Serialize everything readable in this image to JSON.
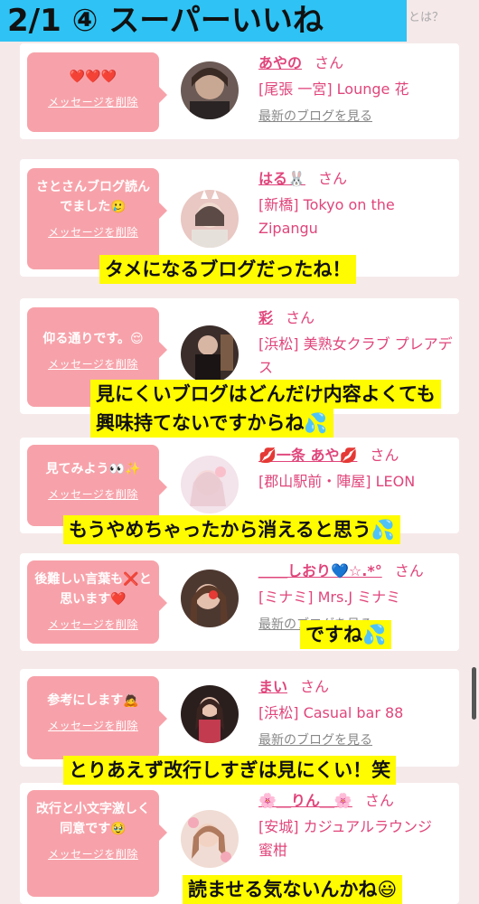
{
  "header": {
    "title": "2/1 ④ スーパーいいね",
    "help_link": "とは？"
  },
  "delete_label": "メッセージを削除",
  "blog_link_label": "最新のブログを見る",
  "san_label": "さん",
  "entries": [
    {
      "message": "❤️❤️❤️",
      "name": "あやの",
      "location": "[尾張 一宮] Lounge 花"
    },
    {
      "message": "さとさんブログ読んでました🥲",
      "name": "はる🐰",
      "location": "[新橋] Tokyo on the Zipangu"
    },
    {
      "message": "仰る通りです。😌",
      "name": "彩",
      "location": "[浜松] 美熟女クラブ プレアデス"
    },
    {
      "message": "見てみよう👀✨",
      "name": "💋一条 あや💋",
      "location": "[郡山駅前・陣屋] LEON"
    },
    {
      "message": "後難しい言葉も❌と思います❤️",
      "name": "＿＿しおり💙☆.*°",
      "location": "[ミナミ] Mrs.J ミナミ"
    },
    {
      "message": "参考にします🙇",
      "name": "まい",
      "location": "[浜松] Casual bar 88"
    },
    {
      "message": "改行と小文字激しく同意です🥹",
      "name": "🌸＿りん＿🌸",
      "location": "[安城] カジュアルラウンジ　蜜柑"
    }
  ],
  "overlays": {
    "o1": "タメになるブログだったね！",
    "o2a": "見にくいブログはどんだけ内容よくても",
    "o2b": "興味持てないですからね💦",
    "o3": "もうやめちゃったから消えると思う💦",
    "o4": "ですね💦",
    "o5": "とりあえず改行しすぎは見にくい！笑",
    "o6": "読ませる気ないんかね😃"
  }
}
